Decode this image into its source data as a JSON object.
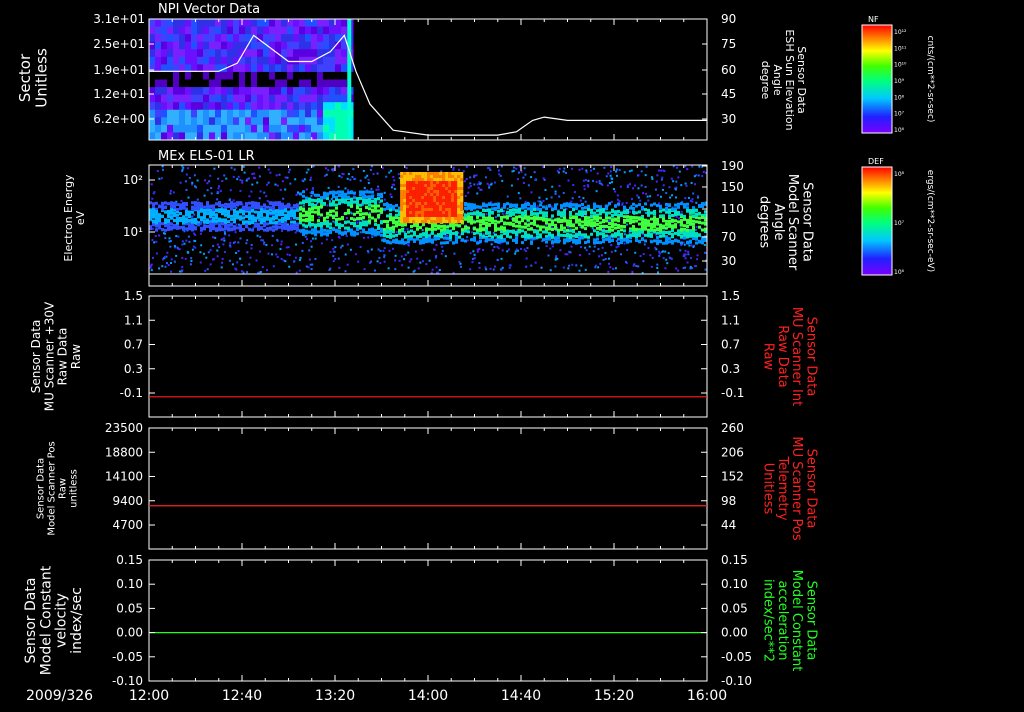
{
  "date_label": "2009/326",
  "time_axis": {
    "start": "12:00",
    "end": "16:00",
    "tick_labels": [
      "12:00",
      "12:40",
      "13:20",
      "14:00",
      "14:40",
      "15:20",
      "16:00"
    ]
  },
  "colorbars": [
    {
      "tag": "NF",
      "unit": "cnts/(cm**2-sr-sec)",
      "tick_labels": [
        "10¹²",
        "10¹¹",
        "10¹⁰",
        "10⁹",
        "10⁸",
        "10⁷",
        "10⁶"
      ]
    },
    {
      "tag": "DEF",
      "unit": "ergs/(cm**2-sr-sec-eV)",
      "tick_labels": [
        "10⁸",
        "10⁷",
        "10⁶"
      ]
    }
  ],
  "chart_data": [
    {
      "type": "heatmap",
      "title": "NPI Vector Data",
      "ylabel": [
        "Sector",
        "Unitless"
      ],
      "y_ticks": [
        "3.1e+01",
        "2.5e+01",
        "1.9e+01",
        "1.2e+01",
        "6.2e+00"
      ],
      "y2label": [
        "Sensor Data",
        "ESH Sun Elevation",
        "Angle",
        "degree"
      ],
      "y2_ticks": [
        "90",
        "75",
        "60",
        "45",
        "30"
      ],
      "y2lim": [
        16,
        90
      ],
      "data_extent_end": "13:27",
      "overlay_line": {
        "axis": "right",
        "color": "#ffffff",
        "x": [
          "12:00",
          "12:30",
          "12:38",
          "12:45",
          "13:00",
          "13:10",
          "13:18",
          "13:24",
          "13:29",
          "13:35",
          "13:45",
          "14:00",
          "14:20",
          "14:30",
          "14:38",
          "14:45",
          "14:50",
          "15:00",
          "15:20",
          "16:00"
        ],
        "y": [
          58,
          58,
          63,
          80,
          64,
          64,
          70,
          80,
          58,
          38,
          22,
          19,
          19,
          19,
          21,
          28,
          30,
          28,
          28,
          28
        ]
      }
    },
    {
      "type": "heatmap",
      "title": "MEx ELS-01 LR",
      "ylabel": [
        "Electron Energy",
        "eV"
      ],
      "y_ticks": [
        "10²",
        "10¹"
      ],
      "y2label": [
        "Sensor Data",
        "Model Scanner",
        "Angle",
        "degrees"
      ],
      "y2_ticks": [
        "190",
        "150",
        "110",
        "70",
        "30"
      ],
      "y2lim": [
        10,
        190
      ],
      "overlay_line": {
        "axis": "right",
        "color": "#ffffff",
        "x": [
          "12:00",
          "16:00"
        ],
        "y": [
          10,
          10
        ]
      }
    },
    {
      "type": "line",
      "ylabel": [
        "Sensor Data",
        "MU Scanner +30V",
        "Raw Data",
        "Raw"
      ],
      "y_ticks": [
        "1.5",
        "1.1",
        "0.7",
        "0.3",
        "-0.1"
      ],
      "ylim": [
        -0.3,
        1.5
      ],
      "y2label": [
        "Sensor Data",
        "MU Scanner Int",
        "Raw Data",
        "Raw"
      ],
      "y2_ticks": [
        "1.5",
        "1.1",
        "0.7",
        "0.3",
        "-0.1"
      ],
      "y2_color": "#ff2020",
      "series": [
        {
          "color": "#ff2020",
          "x": [
            "12:00",
            "16:00"
          ],
          "y": [
            0,
            0
          ]
        }
      ]
    },
    {
      "type": "line",
      "ylabel": [
        "Sensor Data",
        "Model Scanner Pos",
        "Raw",
        "unitless"
      ],
      "y_ticks": [
        "23500",
        "18800",
        "14100",
        "9400",
        "4700"
      ],
      "ylim": [
        0,
        23500
      ],
      "y2label": [
        "Sensor Data",
        "MU Scanner Pos",
        "Telemetry",
        "Unitless"
      ],
      "y2_ticks": [
        "260",
        "206",
        "152",
        "98",
        "44"
      ],
      "y2_color": "#ff2020",
      "series": [
        {
          "color": "#ff2020",
          "x": [
            "12:00",
            "16:00"
          ],
          "y": [
            8400,
            8400
          ]
        }
      ]
    },
    {
      "type": "line",
      "ylabel": [
        "Sensor Data",
        "Model Constant",
        "velocity",
        "index/sec"
      ],
      "y_ticks": [
        "0.15",
        "0.10",
        "0.05",
        "0.00",
        "-0.05",
        "-0.10"
      ],
      "ylim": [
        -0.1,
        0.15
      ],
      "y2label": [
        "Sensor Data",
        "Model Constant",
        "acceleration",
        "index/sec**2"
      ],
      "y2_ticks": [
        "0.15",
        "0.10",
        "0.05",
        "0.00",
        "-0.05",
        "-0.10"
      ],
      "y2_color": "#20ff20",
      "series": [
        {
          "color": "#20ff20",
          "x": [
            "12:00",
            "16:00"
          ],
          "y": [
            0,
            0
          ]
        }
      ]
    }
  ]
}
